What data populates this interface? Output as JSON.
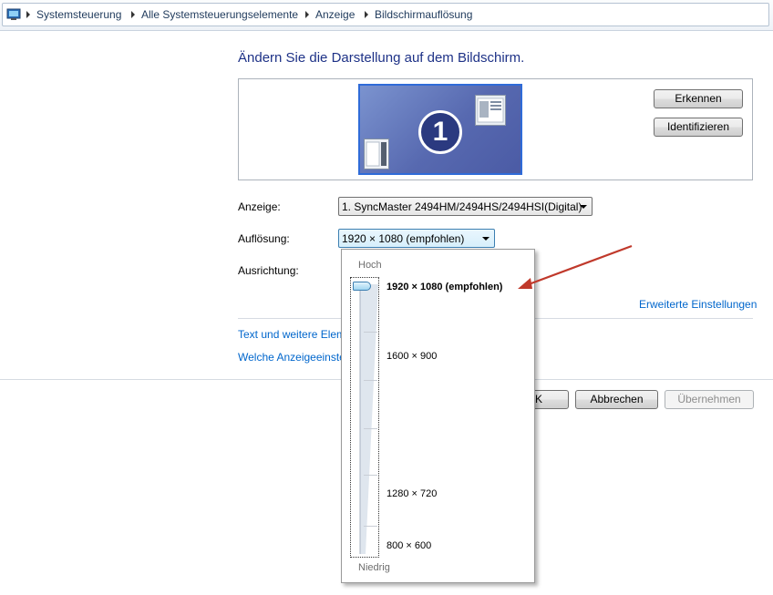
{
  "breadcrumb": {
    "icon": "control-panel-icon",
    "items": [
      "Systemsteuerung",
      "Alle Systemsteuerungselemente",
      "Anzeige",
      "Bildschirmauflösung"
    ]
  },
  "main": {
    "title": "Ändern Sie die Darstellung auf dem Bildschirm.",
    "monitor_number": "1",
    "detect_button": "Erkennen",
    "identify_button": "Identifizieren"
  },
  "form": {
    "display_label": "Anzeige:",
    "display_value": "1. SyncMaster 2494HM/2494HS/2494HSI(Digital)",
    "resolution_label": "Auflösung:",
    "resolution_value": "1920 × 1080 (empfohlen)",
    "orientation_label": "Ausrichtung:",
    "advanced_link": "Erweiterte Einstellungen",
    "link_text_size": "Text und weitere Elem",
    "link_which_settings": "Welche Anzeigeeinste"
  },
  "buttons": {
    "ok": "K",
    "cancel": "Abbrechen",
    "apply": "Übernehmen"
  },
  "dropdown": {
    "high_label": "Hoch",
    "low_label": "Niedrig",
    "resolutions": [
      {
        "label": "1920 × 1080 (empfohlen)",
        "selected": true
      },
      {
        "label": "1600 × 900",
        "selected": false
      },
      {
        "label": "1280 × 720",
        "selected": false
      },
      {
        "label": "800 × 600",
        "selected": false
      }
    ]
  },
  "colors": {
    "accent_link": "#0066cc",
    "title": "#1e3287",
    "annotation_arrow": "#c0392b"
  }
}
